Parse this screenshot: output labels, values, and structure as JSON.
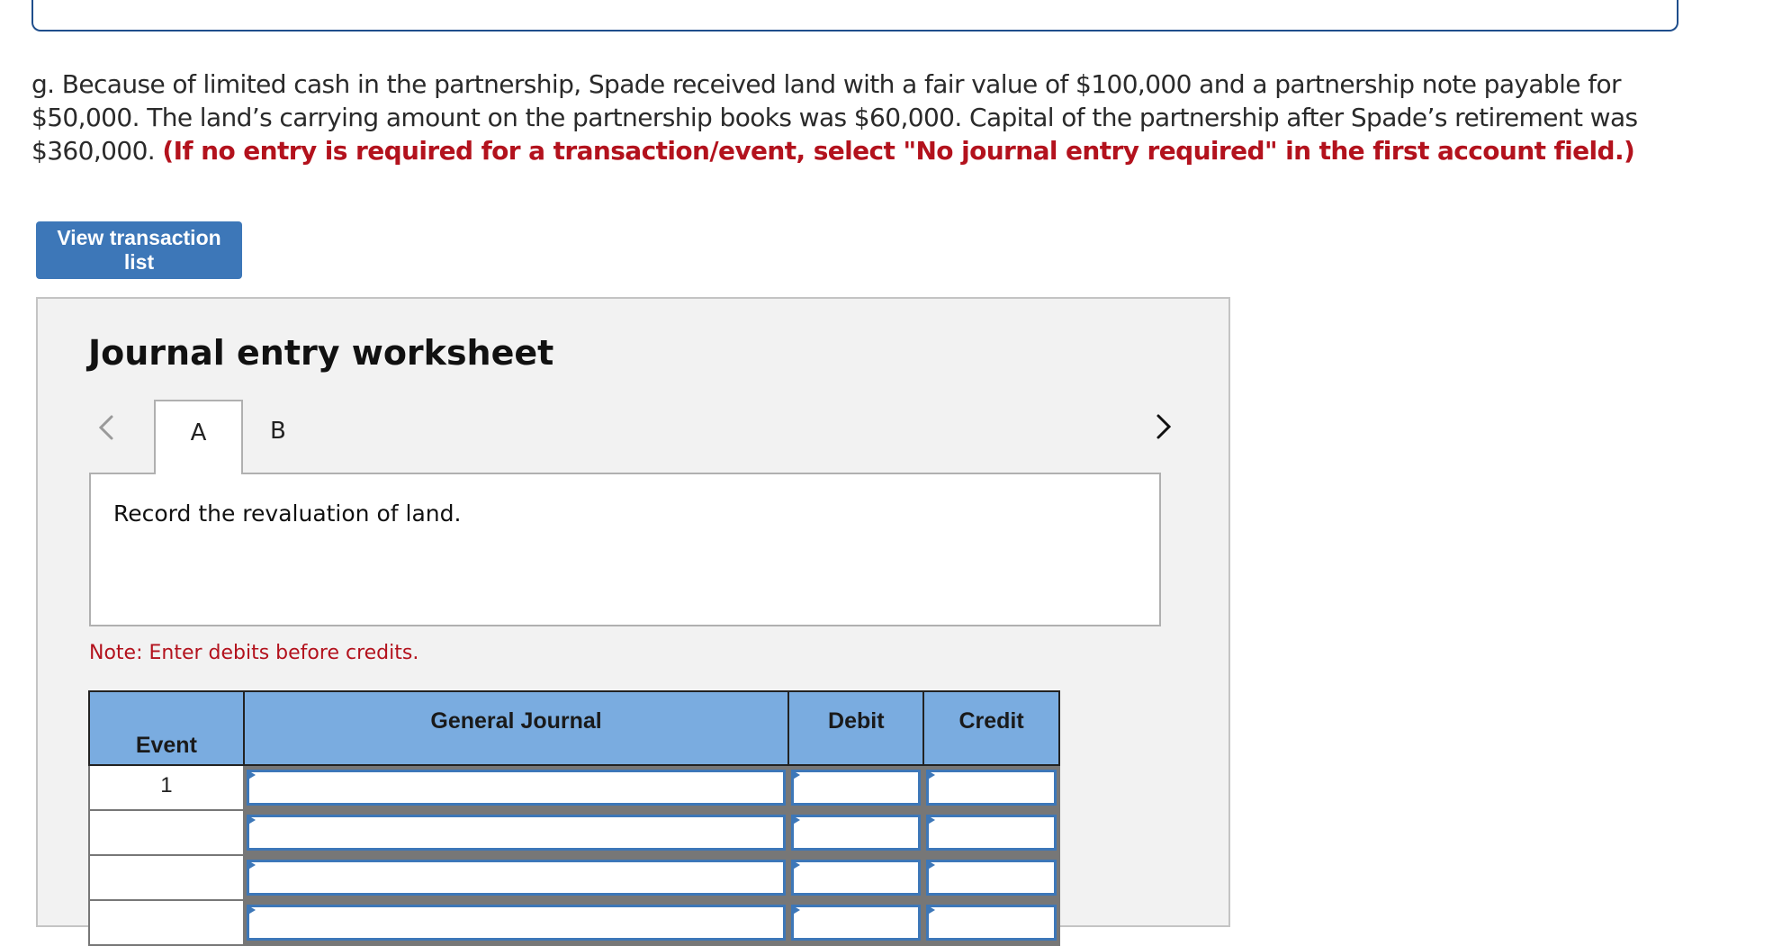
{
  "question": {
    "text": "g. Because of limited cash in the partnership, Spade received land with a fair value of $100,000 and a partnership note payable for $50,000. The land’s carrying amount on the partnership books was $60,000. Capital of the partnership after Spade’s retirement was $360,000.",
    "instruction": "(If no entry is required for a transaction/event, select \"No journal entry required\" in the first account field.)"
  },
  "view_transaction_button": "View transaction list",
  "worksheet": {
    "title": "Journal entry worksheet",
    "tabs": [
      {
        "label": "A",
        "active": true
      },
      {
        "label": "B",
        "active": false
      }
    ],
    "description": "Record the revaluation of land.",
    "note": "Note: Enter debits before credits."
  },
  "table": {
    "headers": {
      "event": "Event",
      "general_journal": "General Journal",
      "debit": "Debit",
      "credit": "Credit"
    },
    "rows": [
      {
        "event": "1",
        "account": "",
        "debit": "",
        "credit": ""
      },
      {
        "event": "",
        "account": "",
        "debit": "",
        "credit": ""
      },
      {
        "event": "",
        "account": "",
        "debit": "",
        "credit": ""
      },
      {
        "event": "",
        "account": "",
        "debit": "",
        "credit": ""
      }
    ]
  },
  "colors": {
    "button_blue": "#3d77b8",
    "header_blue": "#7aace0",
    "instruction_red": "#b3121d",
    "panel_gray": "#f2f2f2"
  }
}
